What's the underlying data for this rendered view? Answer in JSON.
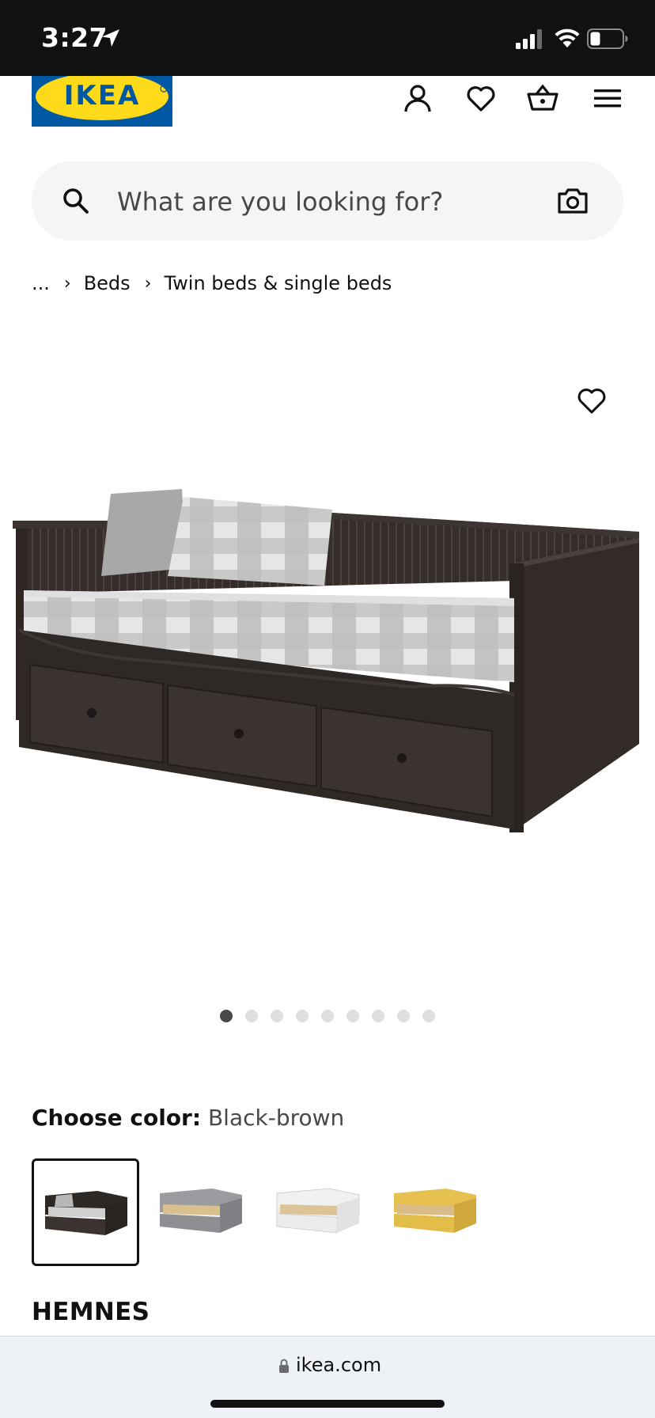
{
  "status_bar": {
    "time": "3:27"
  },
  "header": {
    "logo_text": "IKEA",
    "logo_colors": {
      "background": "#0058a3",
      "oval": "#ffda1a"
    }
  },
  "search": {
    "placeholder": "What are you looking for?"
  },
  "breadcrumb": {
    "items": [
      "...",
      "Beds",
      "Twin beds & single beds"
    ]
  },
  "gallery": {
    "image_count": 9,
    "active_index": 0
  },
  "color_chooser": {
    "label": "Choose color:",
    "selected_value": "Black-brown",
    "swatches": [
      {
        "name": "black-brown",
        "color": "#3a3330"
      },
      {
        "name": "gray",
        "color": "#8d8f92"
      },
      {
        "name": "white",
        "color": "#ececec"
      },
      {
        "name": "yellow",
        "color": "#e3bd4a"
      }
    ]
  },
  "product": {
    "name": "HEMNES"
  },
  "browser": {
    "url": "ikea.com"
  }
}
